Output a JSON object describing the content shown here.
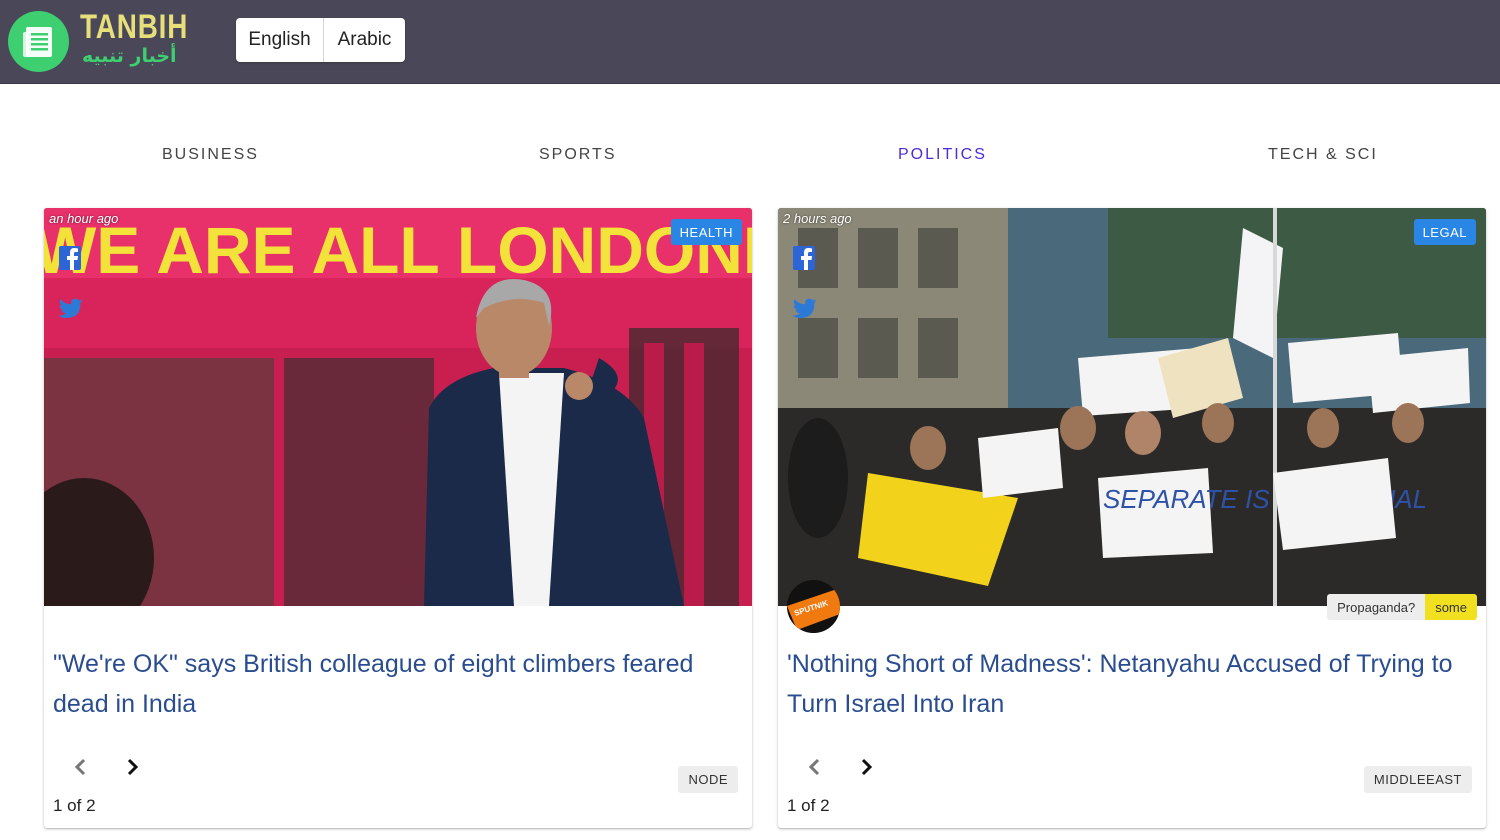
{
  "header": {
    "brand_en": "TANBIH",
    "brand_ar": "أخبار تنبيه",
    "logo_icon": "newspaper-icon",
    "languages": [
      "English",
      "Arabic"
    ],
    "colors": {
      "bar": "#4a4858",
      "brand_yellow": "#e6df7a",
      "brand_green": "#3ed070"
    }
  },
  "nav": {
    "items": [
      "BUSINESS",
      "SPORTS",
      "POLITICS",
      "TECH & SCI"
    ],
    "active": "POLITICS",
    "active_color": "#4f2bd6"
  },
  "cards": [
    {
      "timestamp": "an hour ago",
      "tag": "HEALTH",
      "image_text": "WE ARE ALL LONDONERS",
      "headline": "\"We're OK\" says British colleague of eight climbers feared dead in India",
      "pager": "1 of 2",
      "source": "NODE"
    },
    {
      "timestamp": "2 hours ago",
      "tag": "LEGAL",
      "headline": "'Nothing Short of Madness': Netanyahu Accused of Trying to Turn Israel Into Iran",
      "pager": "1 of 2",
      "source": "MIDDLEEAST",
      "source_logo_text": "SPUTNIK",
      "propaganda_label": "Propaganda?",
      "propaganda_value": "some",
      "sign_texts": [
        "SEPARATE IS NOT EQUAL"
      ]
    }
  ]
}
